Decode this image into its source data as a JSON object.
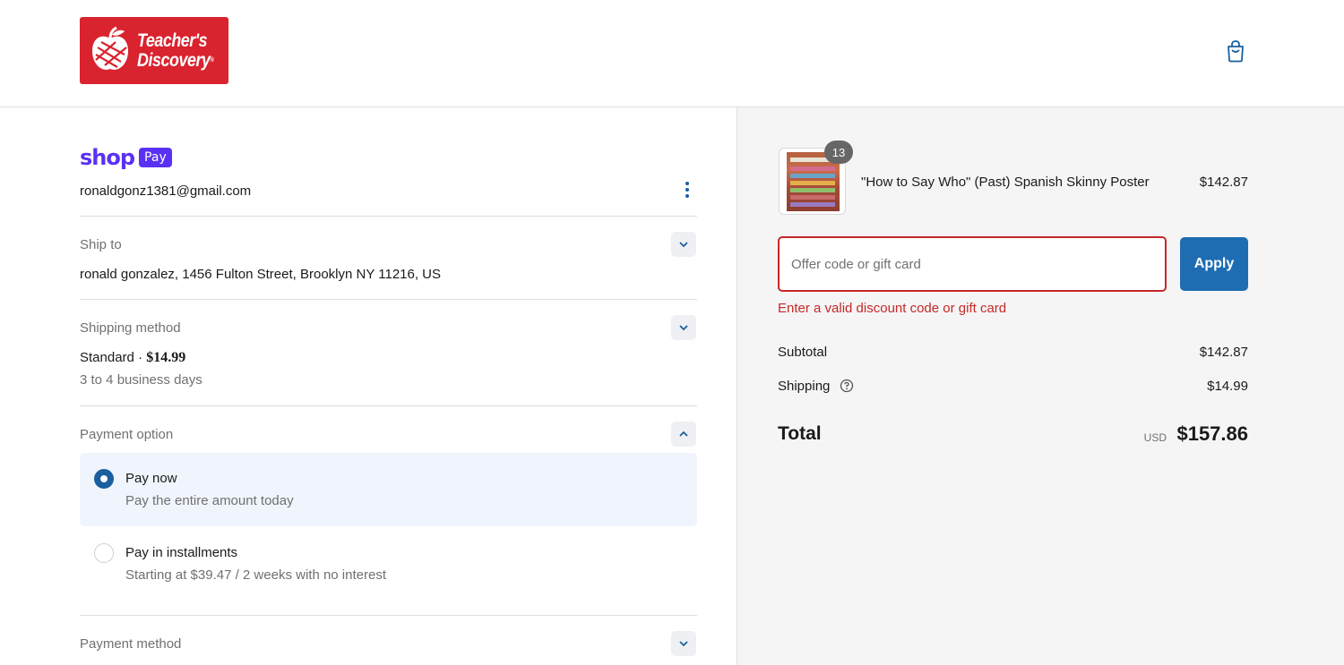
{
  "header": {
    "logo": {
      "line1": "Teacher's",
      "line2": "Discovery",
      "reg_mark": "®"
    },
    "cart_icon": "shopping-bag-icon"
  },
  "colors": {
    "brand_red": "#d9232e",
    "shop_pay_purple": "#5a31f4",
    "accent_blue": "#1e6db3",
    "error_red": "#c62828",
    "summary_bg": "#f5f5f5"
  },
  "account": {
    "shop_word": "shop",
    "pay_badge": "Pay",
    "email": "ronaldgonz1381@gmail.com",
    "menu_icon": "kebab-menu-icon"
  },
  "ship_to": {
    "label": "Ship to",
    "value": "ronald gonzalez, 1456 Fulton Street, Brooklyn NY 11216, US",
    "expand_icon": "chevron-down-icon"
  },
  "shipping_method": {
    "label": "Shipping method",
    "name": "Standard",
    "separator": "·",
    "price": "$14.99",
    "eta": "3 to 4 business days",
    "expand_icon": "chevron-down-icon"
  },
  "payment_option": {
    "label": "Payment option",
    "collapse_icon": "chevron-up-icon",
    "options": [
      {
        "title": "Pay now",
        "subtitle": "Pay the entire amount today",
        "selected": true
      },
      {
        "title": "Pay in installments",
        "subtitle": "Starting at $39.47 / 2 weeks with no interest",
        "selected": false
      }
    ]
  },
  "payment_method": {
    "label": "Payment method",
    "expand_icon": "chevron-down-icon"
  },
  "summary": {
    "product": {
      "quantity": "13",
      "name": "\"How to Say Who\" (Past) Spanish Skinny Poster",
      "price": "$142.87"
    },
    "discount": {
      "placeholder": "Offer code or gift card",
      "value": "",
      "apply_label": "Apply",
      "error": "Enter a valid discount code or gift card"
    },
    "subtotal_label": "Subtotal",
    "subtotal_value": "$142.87",
    "shipping_label": "Shipping",
    "shipping_help_icon": "help-circle-icon",
    "shipping_value": "$14.99",
    "total_label": "Total",
    "currency": "USD",
    "total_value": "$157.86"
  }
}
